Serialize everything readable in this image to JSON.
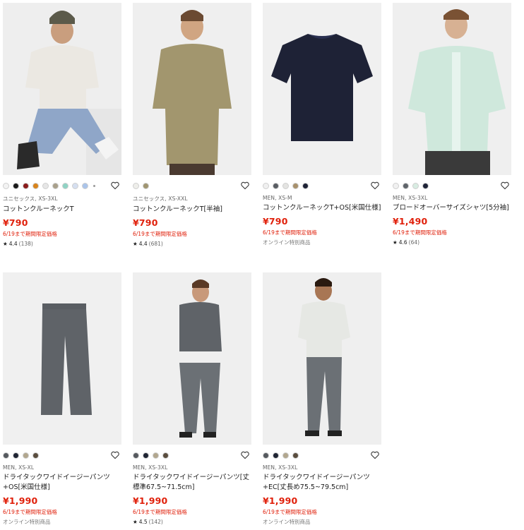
{
  "products": [
    {
      "meta": "ユニセックス, XS-3XL",
      "name": "コットンクルーネックT",
      "price": "¥790",
      "promo": "6/19まで期間限定価格",
      "online": "",
      "rating": "4.4",
      "review_count": "(138)",
      "swatches": [
        "#f3f3f3",
        "#1a1a1a",
        "#8b1c1c",
        "#d8841c",
        "#e6e6e6",
        "#a9a08b",
        "#8fd3c4",
        "#d5dff0",
        "#aac4ea"
      ],
      "more_dot": true
    },
    {
      "meta": "ユニセックス, XS-XXL",
      "name": "コットンクルーネックT[半袖]",
      "price": "¥790",
      "promo": "6/19まで期間限定価格",
      "online": "",
      "rating": "4.4",
      "review_count": "(681)",
      "swatches": [
        "#eeeeea",
        "#a09571"
      ],
      "more_dot": false
    },
    {
      "meta": "MEN, XS-M",
      "name": "コットンクルーネックT+OS[米国仕様]",
      "price": "¥790",
      "promo": "6/19まで期間限定価格",
      "online": "オンライン特別商品",
      "rating": "",
      "review_count": "",
      "swatches": [
        "#f0f0f0",
        "#595d63",
        "#e4e4e2",
        "#a8916c",
        "#1e2236"
      ],
      "more_dot": false
    },
    {
      "meta": "MEN, XS-3XL",
      "name": "ブロードオーバーサイズシャツ[5分袖]",
      "price": "¥1,490",
      "promo": "6/19まで期間限定価格",
      "online": "",
      "rating": "4.6",
      "review_count": "(64)",
      "swatches": [
        "#f1f1f1",
        "#5f646a",
        "#d8ece2",
        "#1f2438"
      ],
      "more_dot": false
    },
    {
      "meta": "MEN, XS-XL",
      "name": "ドライタックワイドイージーパンツ+OS[米国仕様]",
      "price": "¥1,990",
      "promo": "6/19まで期間限定価格",
      "online": "オンライン特別商品",
      "rating": "",
      "review_count": "",
      "swatches": [
        "#55595e",
        "#1f2433",
        "#b2a78e",
        "#5a4d3e"
      ],
      "more_dot": false
    },
    {
      "meta": "MEN, XS-3XL",
      "name": "ドライタックワイドイージーパンツ[丈標準67.5~71.5cm]",
      "price": "¥1,990",
      "promo": "6/19まで期間限定価格",
      "online": "",
      "rating": "4.5",
      "review_count": "(142)",
      "swatches": [
        "#55595e",
        "#1f2433",
        "#b2a78e",
        "#5a4d3e"
      ],
      "more_dot": false
    },
    {
      "meta": "MEN, XS-3XL",
      "name": "ドライタックワイドイージーパンツ+EC[丈長め75.5~79.5cm]",
      "price": "¥1,990",
      "promo": "6/19まで期間限定価格",
      "online": "オンライン特別商品",
      "rating": "",
      "review_count": "",
      "swatches": [
        "#55595e",
        "#1f2433",
        "#b2a78e",
        "#5a4d3e"
      ],
      "more_dot": false
    }
  ],
  "colors": {
    "price_red": "#e0200b",
    "image_bg": "#f2f2f2"
  },
  "icons": {
    "favorite": "heart-icon",
    "rating": "star-icon"
  }
}
